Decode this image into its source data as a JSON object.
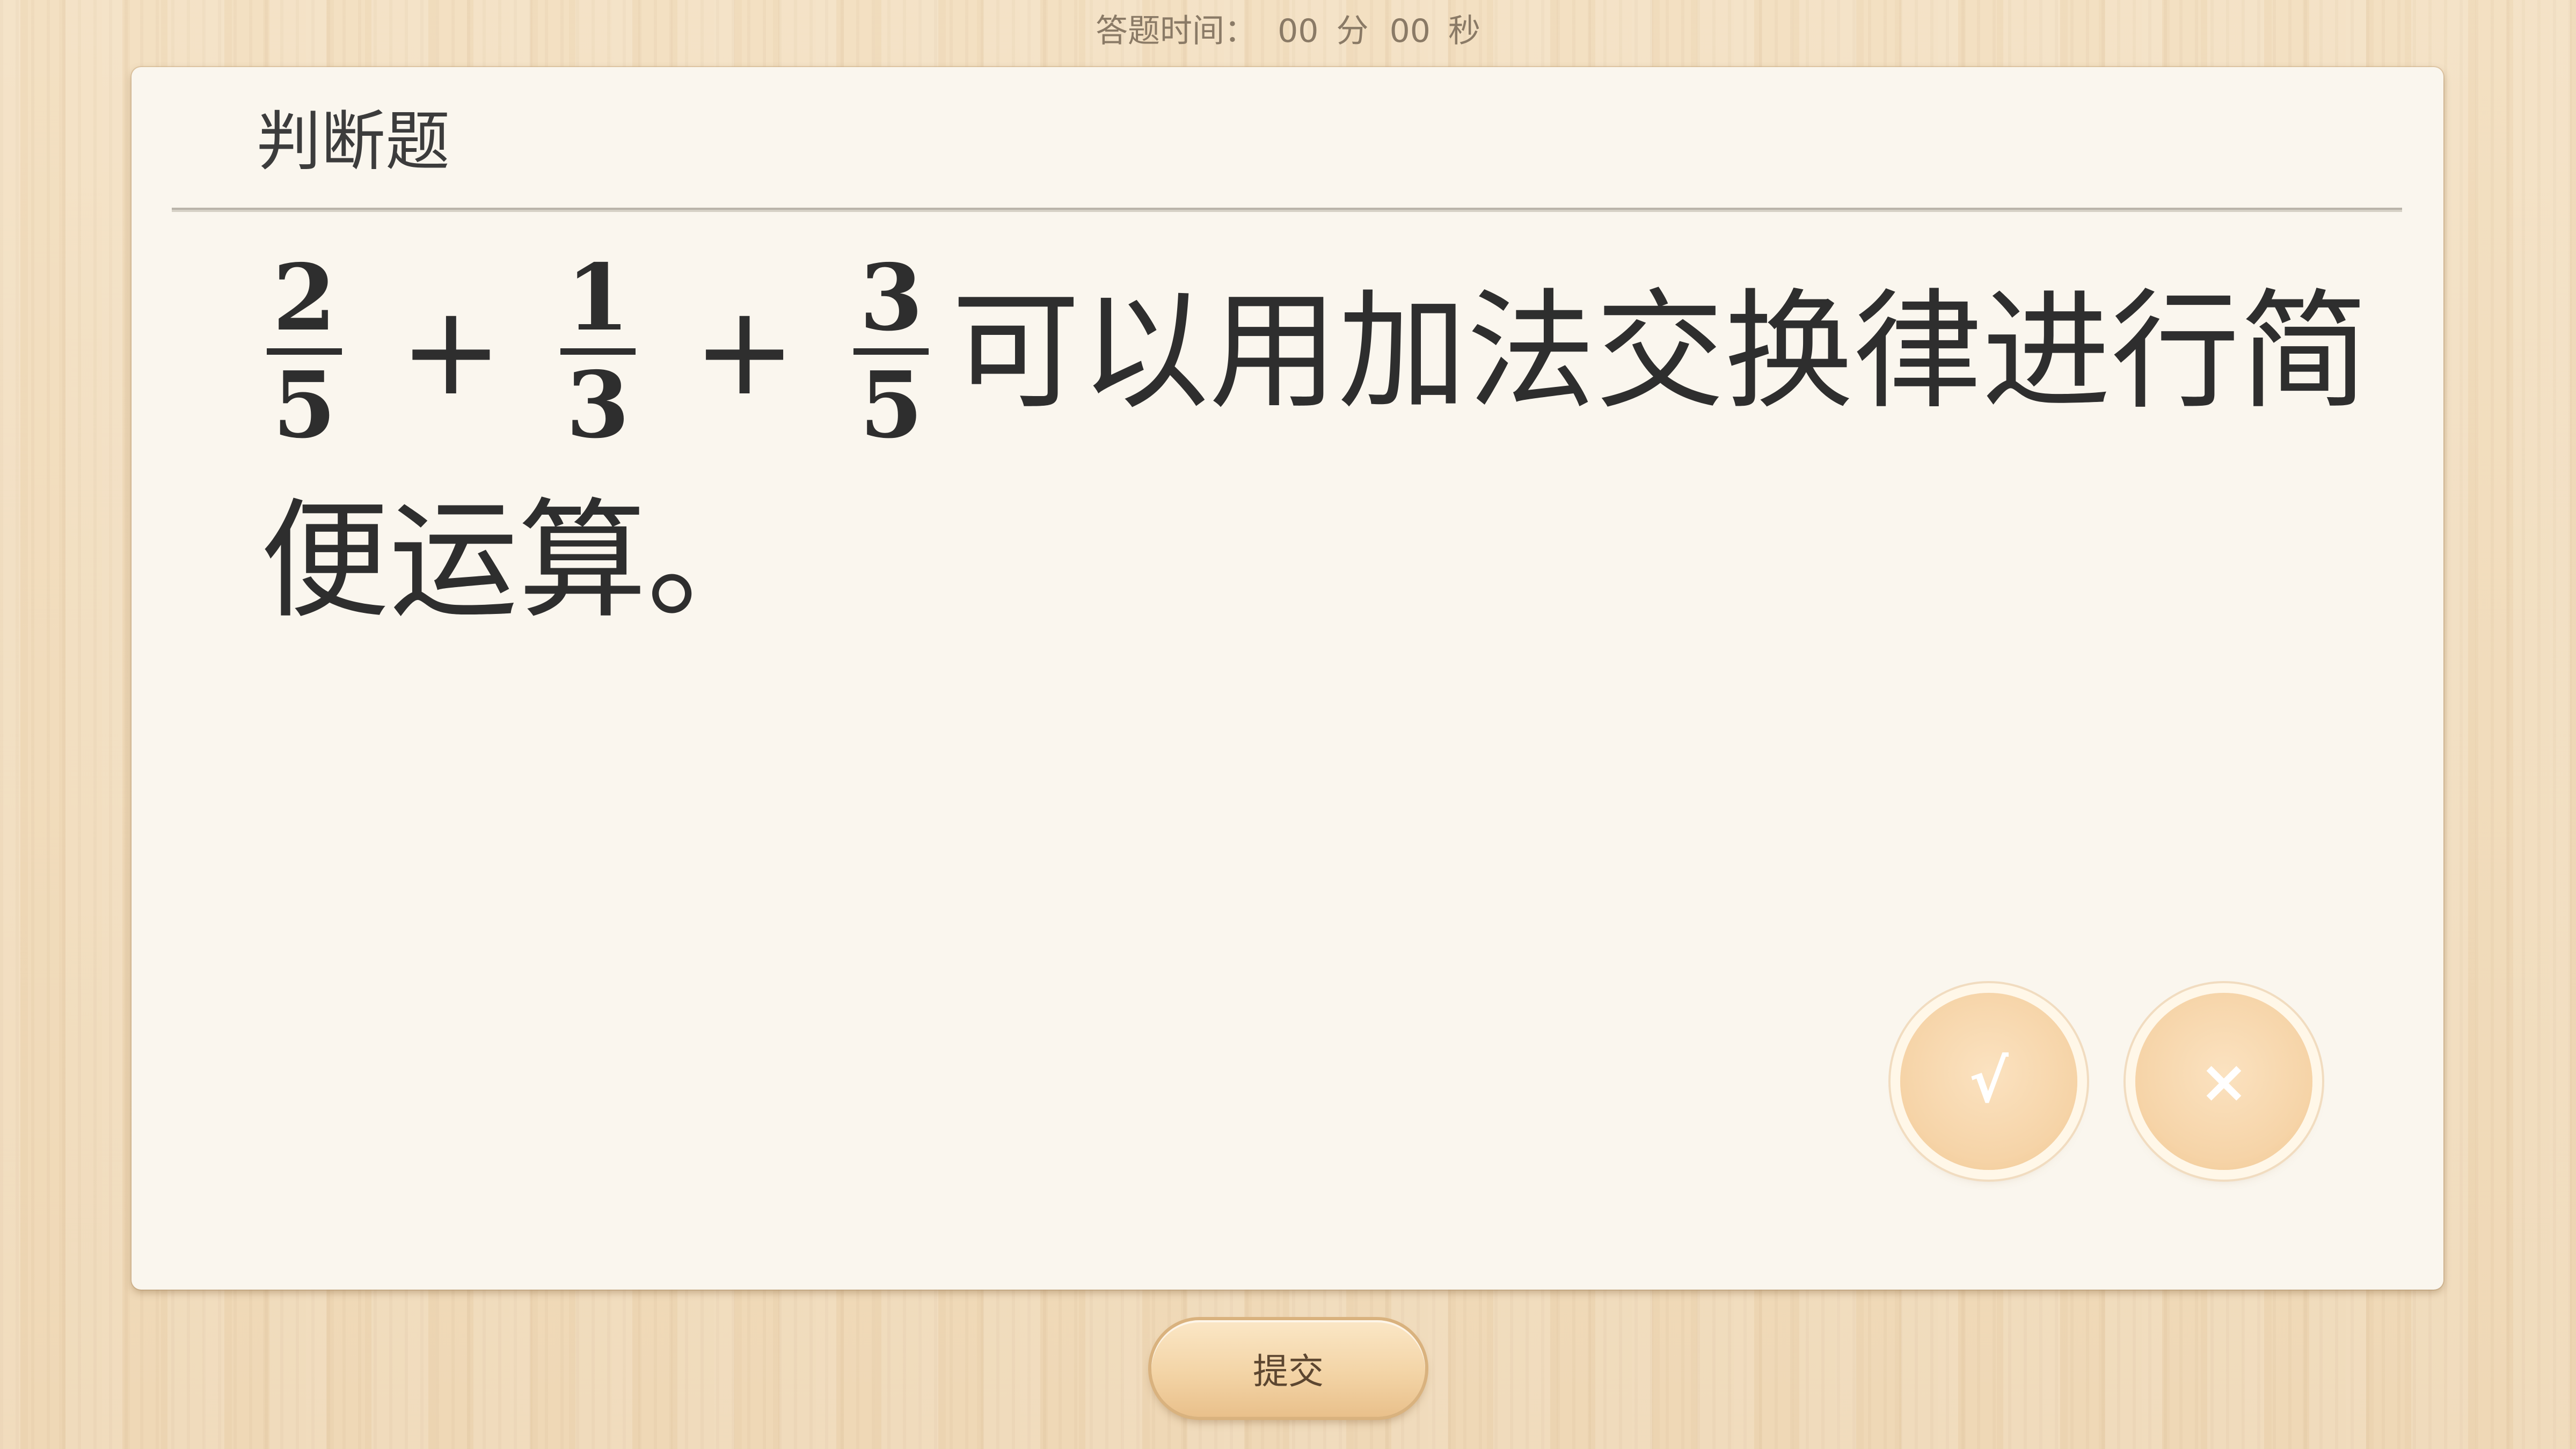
{
  "timer": {
    "label": "答题时间：",
    "minutes": "00",
    "minutes_unit": "分",
    "seconds": "00",
    "seconds_unit": "秒"
  },
  "question": {
    "type_label": "判断题",
    "fractions": [
      {
        "numerator": "2",
        "denominator": "5"
      },
      {
        "numerator": "1",
        "denominator": "3"
      },
      {
        "numerator": "3",
        "denominator": "5"
      }
    ],
    "operators": [
      "+",
      "+"
    ],
    "text_line1": "可以用加法交换律进行简",
    "text_line2": "便运算。"
  },
  "answers": {
    "true_symbol": "√",
    "false_symbol": "×"
  },
  "submit": {
    "label": "提交"
  }
}
